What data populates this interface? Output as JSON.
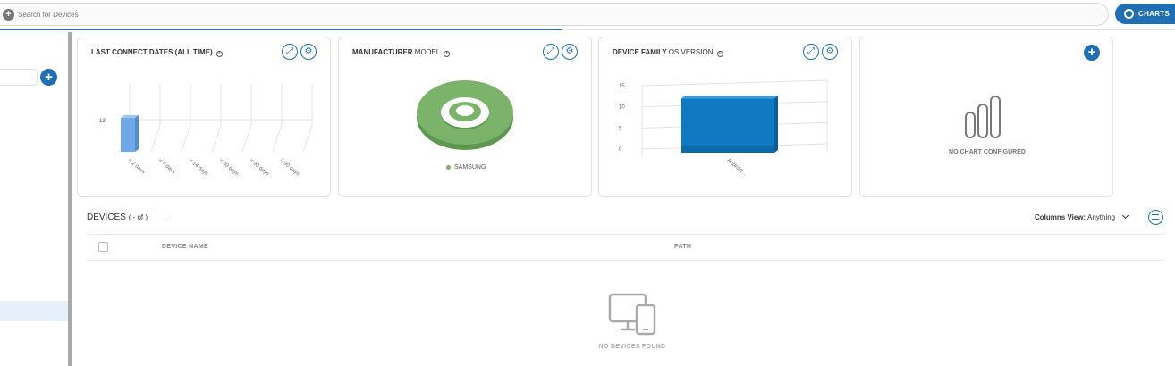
{
  "search": {
    "placeholder": "Search for Devices"
  },
  "toolbar": {
    "charts_label": "CHARTS"
  },
  "cards": [
    {
      "title": "LAST CONNECT DATES (ALL TIME)",
      "title_light": "",
      "chart_data": {
        "type": "bar",
        "categories": [
          "< 2 days",
          "< 7 days",
          "< 14 days",
          "< 30 days",
          "< 90 days",
          "> 90 days"
        ],
        "values": [
          13,
          0,
          0,
          0,
          0,
          0
        ],
        "data_label": "13",
        "color": "#6fa8e8"
      }
    },
    {
      "title": "MANUFACTURER",
      "title_light": "MODEL",
      "chart_data": {
        "type": "pie",
        "categories": [
          "SAMSUNG"
        ],
        "values": [
          100
        ],
        "color": "#7cb36b"
      },
      "legend": "SAMSUNG"
    },
    {
      "title": "DEVICE FAMILY",
      "title_light": "OS VERSION",
      "chart_data": {
        "type": "bar",
        "categories": [
          "Android ..."
        ],
        "values": [
          12
        ],
        "y_ticks": [
          "0",
          "5",
          "10",
          "15"
        ],
        "ylim": [
          0,
          15
        ],
        "color": "#0f7ac2"
      }
    },
    {
      "title": "",
      "empty_label": "NO CHART CONFIGURED"
    }
  ],
  "devices": {
    "title": "DEVICES",
    "count_text": "( - of )",
    "extra": ",",
    "columns_view_label": "Columns View:",
    "columns_view_value": "Anything",
    "columns": [
      "DEVICE NAME",
      "PATH"
    ],
    "empty_text": "NO DEVICES FOUND"
  },
  "colors": {
    "accent": "#1f6fb2"
  }
}
